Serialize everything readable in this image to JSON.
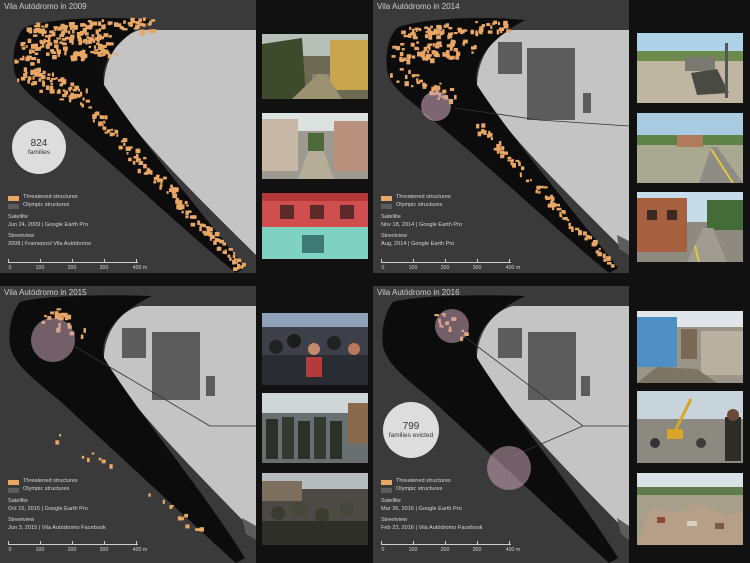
{
  "panels": [
    {
      "title": "Vila Autódromo in 2009",
      "legend": {
        "threatened": "Threatened structures",
        "olympic": "Olympic structures"
      },
      "satellite_label": "Satellite",
      "satellite": "Jun 24, 2009 | Google Earth Pro",
      "streetview_label": "Streetview",
      "streetview": "2008 | Framepool Vila Autódromo",
      "stat": {
        "number": "824",
        "label": "families"
      }
    },
    {
      "title": "Vila Autódromo in 2014",
      "legend": {
        "threatened": "Threatened structures",
        "olympic": "Olympic structures"
      },
      "satellite_label": "Satellite",
      "satellite": "Nov 18, 2014 | Google Earth Pro",
      "streetview_label": "Streetview",
      "streetview": "Aug, 2014 | Google Earth Pro"
    },
    {
      "title": "Vila Autódromo in 2015",
      "legend": {
        "threatened": "Threatened structures",
        "olympic": "Olympic structures"
      },
      "satellite_label": "Satellite",
      "satellite": "Oct 15, 2015 | Google Earth Pro",
      "streetview_label": "Streetview",
      "streetview": "Jun 3, 2015 | Vila Autódromo Facebook"
    },
    {
      "title": "Vila Autódromo in 2016",
      "legend": {
        "threatened": "Threatened structures",
        "olympic": "Olympic structures"
      },
      "satellite_label": "Satellite",
      "satellite": "Mar 26, 2016 | Google Earth Pro",
      "streetview_label": "Streetview",
      "streetview": "Feb 23, 2016 | Vila Autódromo Facebook",
      "stat": {
        "number": "799",
        "label": "families evicted"
      }
    }
  ],
  "scale": {
    "ticks": [
      "0",
      "100",
      "200",
      "300",
      "400 m"
    ]
  },
  "colors": {
    "threatened": "#e8a765",
    "olympic": "#5c5c5c",
    "land": "#c4c4c4",
    "water": "#3a3a3a",
    "community": "#0c0c0c",
    "highlight": "#c8a4b4"
  }
}
